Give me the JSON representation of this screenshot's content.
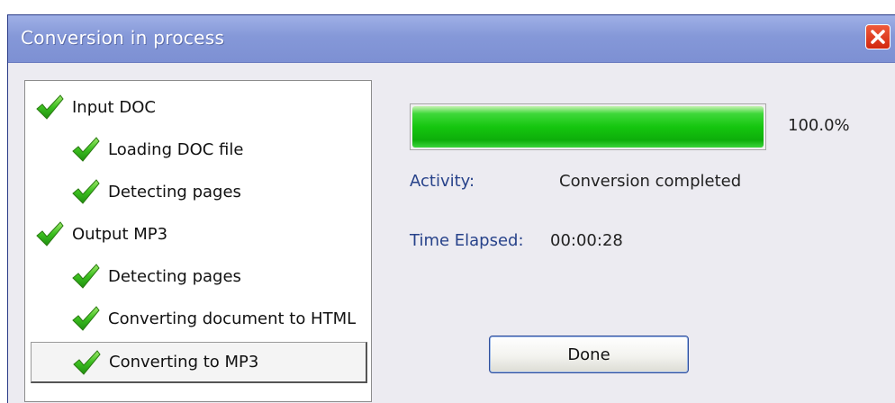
{
  "window": {
    "title": "Conversion in process"
  },
  "steps": [
    {
      "label": "Input DOC",
      "status": "done"
    },
    {
      "label": "Loading DOC file",
      "status": "done"
    },
    {
      "label": "Detecting pages",
      "status": "done"
    },
    {
      "label": "Output MP3",
      "status": "done"
    },
    {
      "label": "Detecting pages",
      "status": "done"
    },
    {
      "label": "Converting document to HTML",
      "status": "done"
    },
    {
      "label": "Converting to MP3",
      "status": "done",
      "selected": true
    }
  ],
  "progress": {
    "value_fraction": 1.0,
    "percent_text": "100.0%"
  },
  "activity": {
    "label": "Activity:",
    "value": "Conversion completed"
  },
  "elapsed": {
    "label": "Time Elapsed:",
    "value": "00:00:28"
  },
  "buttons": {
    "done_label": "Done"
  },
  "colors": {
    "progress_green": "#15c60f",
    "label_blue": "#27428a",
    "titlebar": "#8598d8",
    "close_red": "#d1280f"
  },
  "icons": {
    "step_status": "check-icon",
    "close": "close-icon"
  }
}
